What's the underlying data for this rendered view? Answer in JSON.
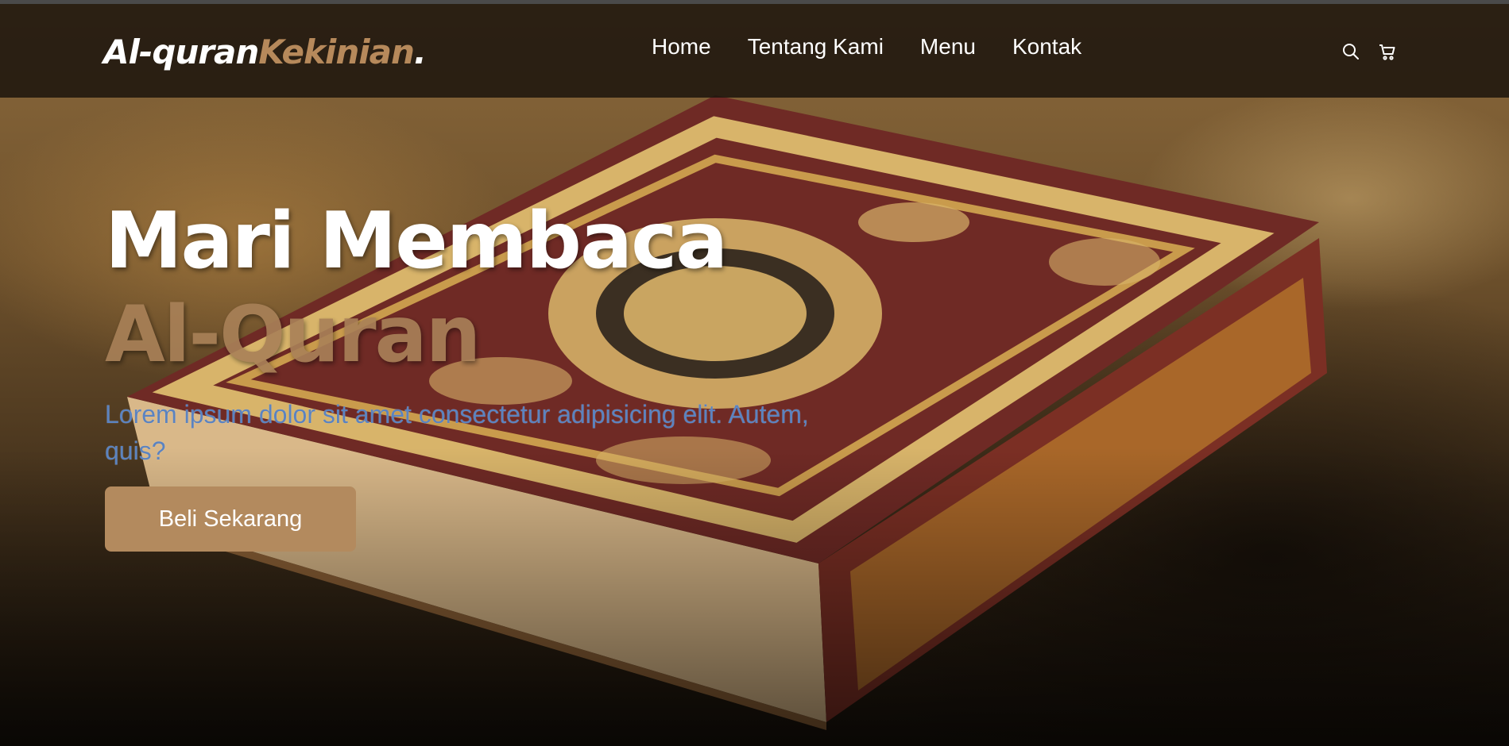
{
  "brand": {
    "primary": "Al-quran",
    "accent": "Kekinian",
    "dot": "."
  },
  "nav": {
    "links": [
      "Home",
      "Tentang Kami",
      "Menu",
      "Kontak"
    ],
    "icons": [
      "search-icon",
      "cart-icon"
    ]
  },
  "hero": {
    "title_line1": "Mari Membaca",
    "title_line2": "Al-Quran",
    "description": "Lorem ipsum dolor sit amet consectetur adipisicing elit. Autem, quis?",
    "cta_label": "Beli Sekarang"
  },
  "colors": {
    "accent": "#b6895b",
    "nav_bg": "#1e160e",
    "lead_text": "#5b83c0",
    "button": "#b38a5e"
  }
}
